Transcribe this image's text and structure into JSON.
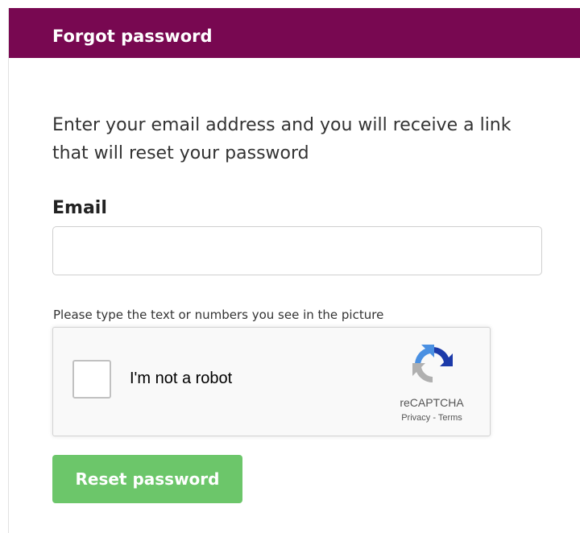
{
  "panel": {
    "title": "Forgot password",
    "header_color": "#780851"
  },
  "form": {
    "intro_text": "Enter your email address and you will receive a link that will reset your password",
    "email_label": "Email",
    "email_value": "",
    "email_placeholder": "",
    "captcha_hint": "Please type the text or numbers you see in the picture",
    "submit_label": "Reset password",
    "submit_color": "#6cc66a"
  },
  "recaptcha": {
    "checkbox_label": "I'm not a robot",
    "checked": false,
    "brand": "reCAPTCHA",
    "privacy_label": "Privacy",
    "separator": "-",
    "terms_label": "Terms",
    "logo_icon": "recaptcha-logo-icon"
  }
}
